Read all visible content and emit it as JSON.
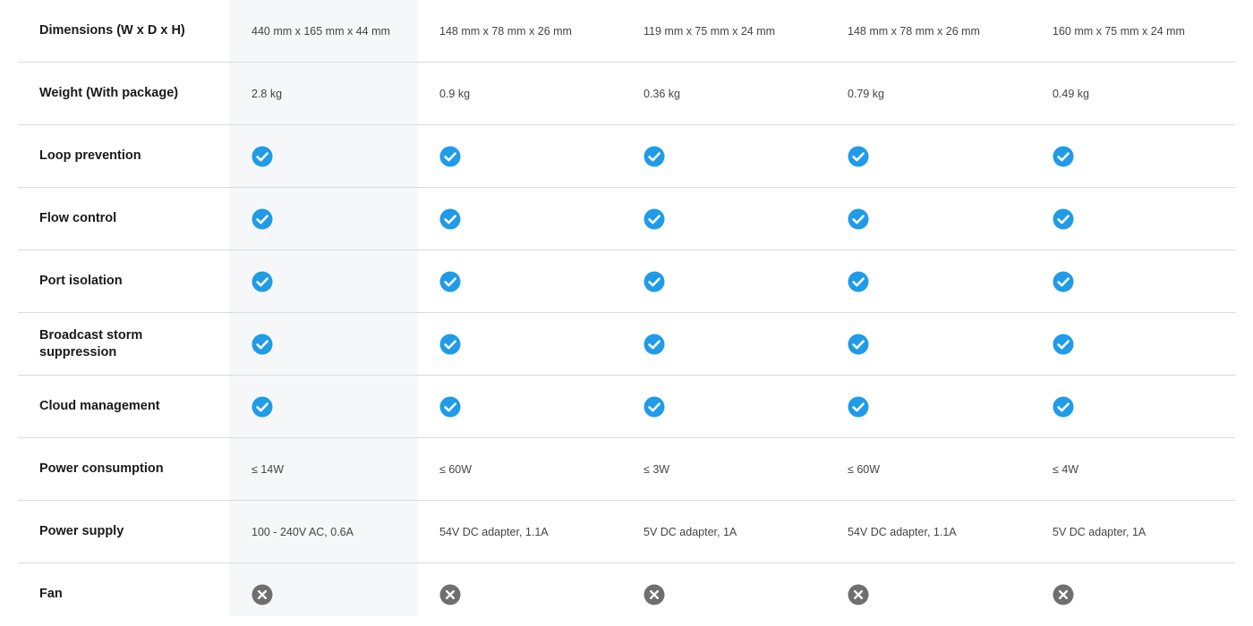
{
  "colors": {
    "check": "#1f9be8",
    "cross": "#6f6f6f",
    "highlight_column": "#f6f7f9",
    "divider": "#d9dcdf"
  },
  "icons": {
    "yes": "check-circle-icon",
    "no": "x-circle-icon"
  },
  "rows": [
    {
      "label": "Dimensions (W x D x H)",
      "type": "text",
      "values": [
        "440 mm x 165 mm x 44 mm",
        "148 mm x 78 mm x 26 mm",
        "119 mm x 75 mm x 24 mm",
        "148 mm x 78 mm x 26 mm",
        "160 mm x 75 mm x 24 mm"
      ]
    },
    {
      "label": "Weight (With package)",
      "type": "text",
      "values": [
        "2.8 kg",
        "0.9 kg",
        "0.36 kg",
        "0.79 kg",
        "0.49 kg"
      ]
    },
    {
      "label": "Loop prevention",
      "type": "icon",
      "values": [
        "yes",
        "yes",
        "yes",
        "yes",
        "yes"
      ]
    },
    {
      "label": "Flow control",
      "type": "icon",
      "values": [
        "yes",
        "yes",
        "yes",
        "yes",
        "yes"
      ]
    },
    {
      "label": "Port isolation",
      "type": "icon",
      "values": [
        "yes",
        "yes",
        "yes",
        "yes",
        "yes"
      ]
    },
    {
      "label": "Broadcast storm suppression",
      "type": "icon",
      "values": [
        "yes",
        "yes",
        "yes",
        "yes",
        "yes"
      ]
    },
    {
      "label": "Cloud management",
      "type": "icon",
      "values": [
        "yes",
        "yes",
        "yes",
        "yes",
        "yes"
      ]
    },
    {
      "label": "Power consumption",
      "type": "text",
      "values": [
        "≤ 14W",
        "≤ 60W",
        "≤ 3W",
        "≤ 60W",
        "≤ 4W"
      ]
    },
    {
      "label": "Power supply",
      "type": "text",
      "values": [
        "100 - 240V AC, 0.6A",
        "54V DC adapter, 1.1A",
        "5V DC adapter, 1A",
        "54V DC adapter, 1.1A",
        "5V DC adapter, 1A"
      ]
    },
    {
      "label": "Fan",
      "type": "icon",
      "values": [
        "no",
        "no",
        "no",
        "no",
        "no"
      ]
    }
  ]
}
